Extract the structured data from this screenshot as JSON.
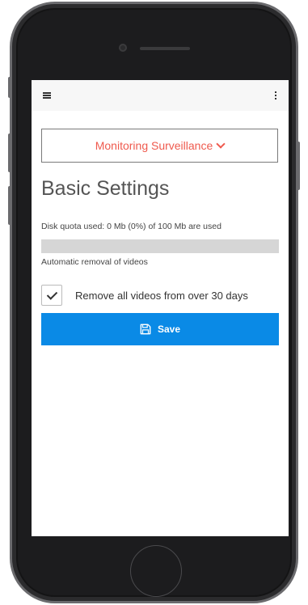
{
  "topbar": {
    "menu_icon": "hamburger-menu-icon",
    "more_icon": "kebab-more-icon"
  },
  "dropdown": {
    "label": "Monitoring Surveillance",
    "icon": "chevron-down-icon",
    "color": "#ef5a4e"
  },
  "settings": {
    "title": "Basic Settings",
    "quota_text": "Disk quota used: 0 Mb (0%) of 100 Mb are used",
    "quota_percent": 0,
    "auto_removal_text": "Automatic removal of videos",
    "remove_checkbox": {
      "label": "Remove all videos from over 30 days",
      "checked": true
    }
  },
  "save_button": {
    "label": "Save",
    "icon": "floppy-disk-icon",
    "color": "#0a8ae6"
  }
}
